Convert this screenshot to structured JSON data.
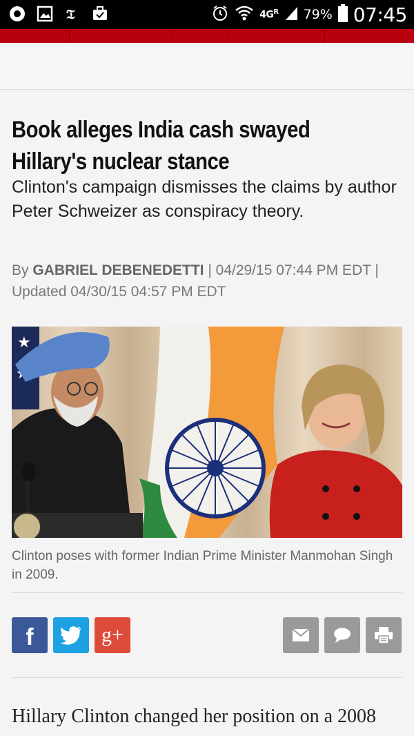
{
  "status_bar": {
    "network": "4G",
    "network_sub": "R",
    "battery_percent": "79%",
    "time": "07:45"
  },
  "article": {
    "headline": "Book alleges India cash swayed Hillary's nuclear stance",
    "subhead": "Clinton's campaign dismisses the claims by author Peter Schweizer as conspiracy theory.",
    "byline": {
      "by": "By",
      "author": "GABRIEL DEBENEDETTI",
      "published": "| 04/29/15 07:44 PM EDT |",
      "updated": "Updated 04/30/15 04:57 PM EDT"
    },
    "photo_caption": "Clinton poses with former Indian Prime Minister Manmohan Singh in 2009.",
    "body_first_line": "Hillary Clinton changed her position on a 2008"
  },
  "share": {
    "facebook_label": "f",
    "google_label": "g+",
    "icons": [
      "facebook-icon",
      "twitter-icon",
      "google-plus-icon",
      "mail-icon",
      "comment-icon",
      "print-icon"
    ]
  },
  "colors": {
    "nav_red": "#b8000e",
    "facebook": "#3b5998",
    "twitter": "#1da1e2",
    "google": "#dc4a38",
    "utility_gray": "#9a9a9a"
  }
}
